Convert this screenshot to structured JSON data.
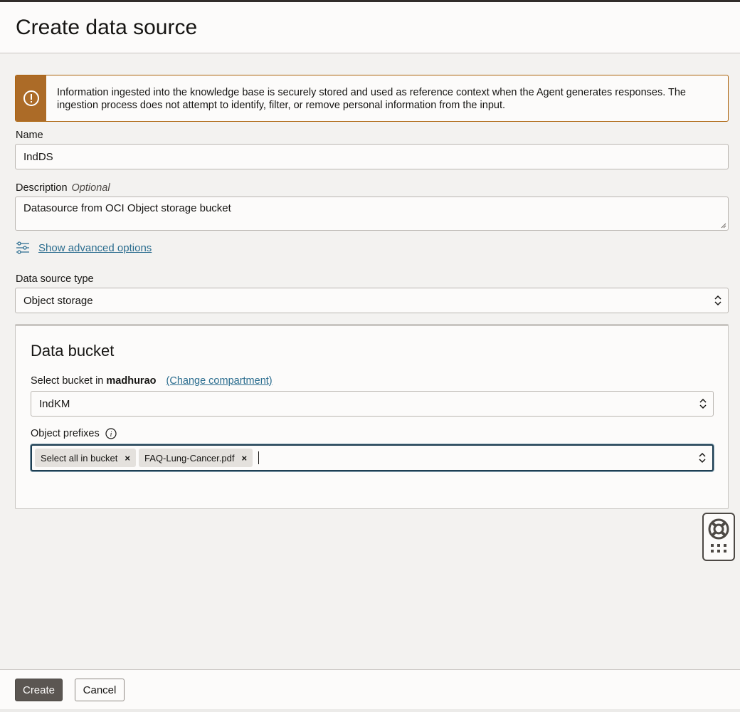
{
  "dialog": {
    "title": "Create data source"
  },
  "alert": {
    "text": "Information ingested into the knowledge base is securely stored and used as reference context when the Agent generates responses. The ingestion process does not attempt to identify, filter, or remove personal information from the input."
  },
  "form": {
    "name_label": "Name",
    "name_value": "IndDS",
    "description_label": "Description",
    "description_optional": "Optional",
    "description_value": "Datasource from OCI Object storage bucket",
    "advanced_link": "Show advanced options",
    "source_type_label": "Data source type",
    "source_type_value": "Object storage"
  },
  "bucket_panel": {
    "title": "Data bucket",
    "select_bucket_prefix": "Select bucket in",
    "compartment": "madhurao",
    "change_compartment": "(Change compartment)",
    "bucket_value": "IndKM",
    "prefixes_label": "Object prefixes",
    "prefixes": [
      {
        "label": "Select all in bucket"
      },
      {
        "label": "FAQ-Lung-Cancer.pdf"
      }
    ],
    "chip_remove": "×"
  },
  "footer": {
    "create_label": "Create",
    "cancel_label": "Cancel"
  },
  "colors": {
    "warning": "#ac6b27",
    "primary_button": "#5b5652",
    "link": "#2b6d8f"
  }
}
